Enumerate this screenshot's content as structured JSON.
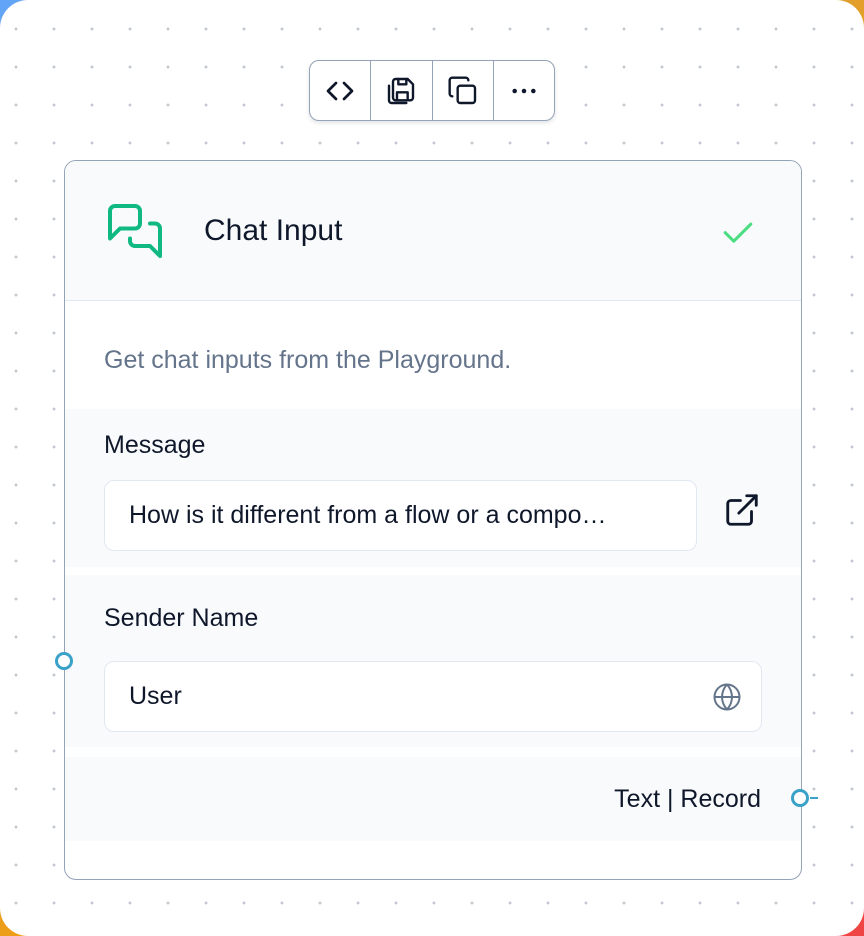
{
  "toolbar": {
    "buttons": [
      {
        "name": "code",
        "icon": "code-icon"
      },
      {
        "name": "save",
        "icon": "save-icon"
      },
      {
        "name": "duplicate",
        "icon": "copy-icon"
      },
      {
        "name": "more",
        "icon": "more-horizontal-icon"
      }
    ]
  },
  "node": {
    "title": "Chat Input",
    "icon": "messages-square-icon",
    "status_icon": "check-icon",
    "description": "Get chat inputs from the Playground.",
    "fields": {
      "message": {
        "label": "Message",
        "value": "How is it different from a flow or a compo…",
        "action_icon": "external-link-icon"
      },
      "sender_name": {
        "label": "Sender Name",
        "value": "User",
        "action_icon": "globe-icon"
      }
    },
    "output": {
      "label": "Text | Record"
    }
  },
  "colors": {
    "accent_green": "#10b981",
    "check_green": "#4ade80",
    "handle_blue": "#3aa1c9",
    "border": "#94a3b8"
  }
}
